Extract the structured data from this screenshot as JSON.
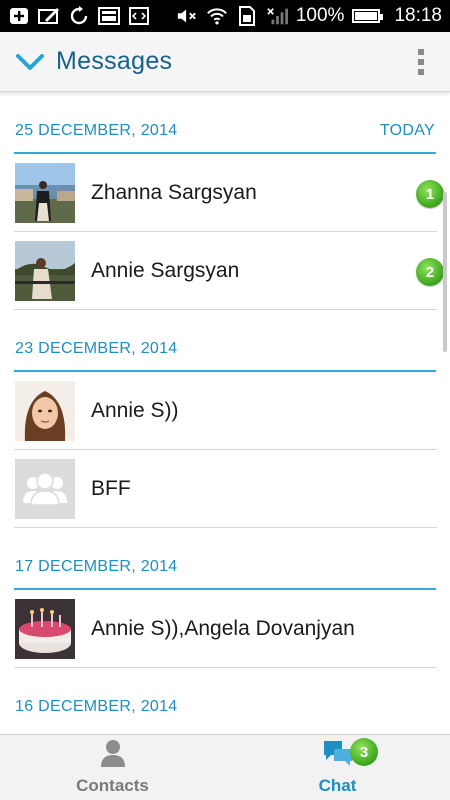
{
  "status_bar": {
    "battery_percent": "100%",
    "time": "18:18"
  },
  "header": {
    "title": "Messages"
  },
  "sections": [
    {
      "date": "25 DECEMBER, 2014",
      "tag": "TODAY",
      "conversations": [
        {
          "name": "Zhanna Sargsyan",
          "unread": "1",
          "avatar": "photo-city"
        },
        {
          "name": "Annie Sargsyan",
          "unread": "2",
          "avatar": "photo-park"
        }
      ]
    },
    {
      "date": "23 DECEMBER, 2014",
      "tag": "",
      "conversations": [
        {
          "name": "Annie S))",
          "unread": "",
          "avatar": "photo-portrait"
        },
        {
          "name": "BFF",
          "unread": "",
          "avatar": "group-placeholder"
        }
      ]
    },
    {
      "date": "17 DECEMBER, 2014",
      "tag": "",
      "conversations": [
        {
          "name": "Annie S)),Angela Dovanjyan",
          "unread": "",
          "avatar": "photo-cake"
        }
      ]
    },
    {
      "date": "16 DECEMBER, 2014",
      "tag": "",
      "conversations": []
    }
  ],
  "bottom_nav": {
    "contacts_label": "Contacts",
    "chat_label": "Chat",
    "chat_badge": "3"
  },
  "colors": {
    "accent": "#1e8fc2",
    "title": "#17618a",
    "badge_green": "#3ba31c"
  }
}
